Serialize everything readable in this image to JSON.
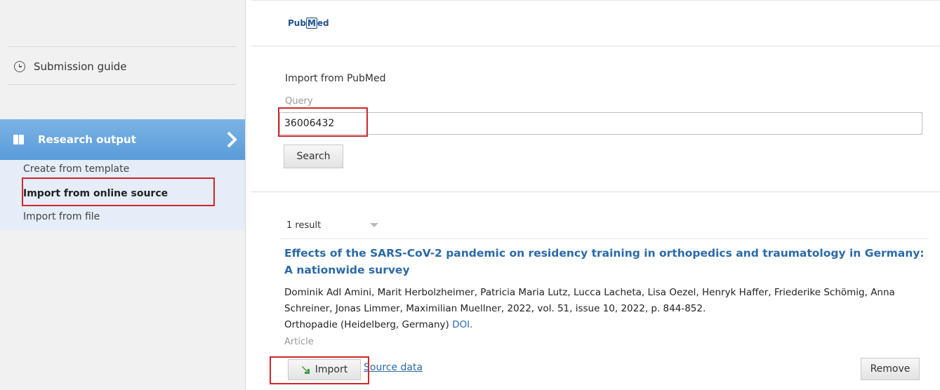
{
  "sidebar": {
    "guide_label": "Submission guide",
    "research_label": "Research output",
    "sub_items": [
      "Create from template",
      "Import from online source",
      "Import from file"
    ]
  },
  "logo": {
    "pub": "Pub",
    "med": "M",
    "ed": "ed"
  },
  "form": {
    "title": "Import from PubMed",
    "query_label": "Query",
    "query_value": "36006432",
    "search_label": "Search"
  },
  "results": {
    "count_label": "1 result",
    "article": {
      "title": "Effects of the SARS-CoV-2 pandemic on residency training in orthopedics and traumatology in Germany: A nationwide survey",
      "authors": "Dominik Adl Amini, Marit Herbolzheimer, Patricia Maria Lutz, Lucca Lacheta, Lisa Oezel, Henryk Haffer, Friederike Schömig, Anna Schreiner, Jonas Limmer, Maximilian Muellner, 2022, vol. 51, issue 10, 2022, p. 844-852.",
      "journal": "Orthopadie (Heidelberg, Germany)",
      "doi_label": "DOI.",
      "type": "Article",
      "import_label": "Import",
      "source_label": "Source data",
      "remove_label": "Remove"
    }
  },
  "colors": {
    "accent": "#5a9bd8",
    "link": "#2b6aa8",
    "highlight": "#d0272d"
  }
}
